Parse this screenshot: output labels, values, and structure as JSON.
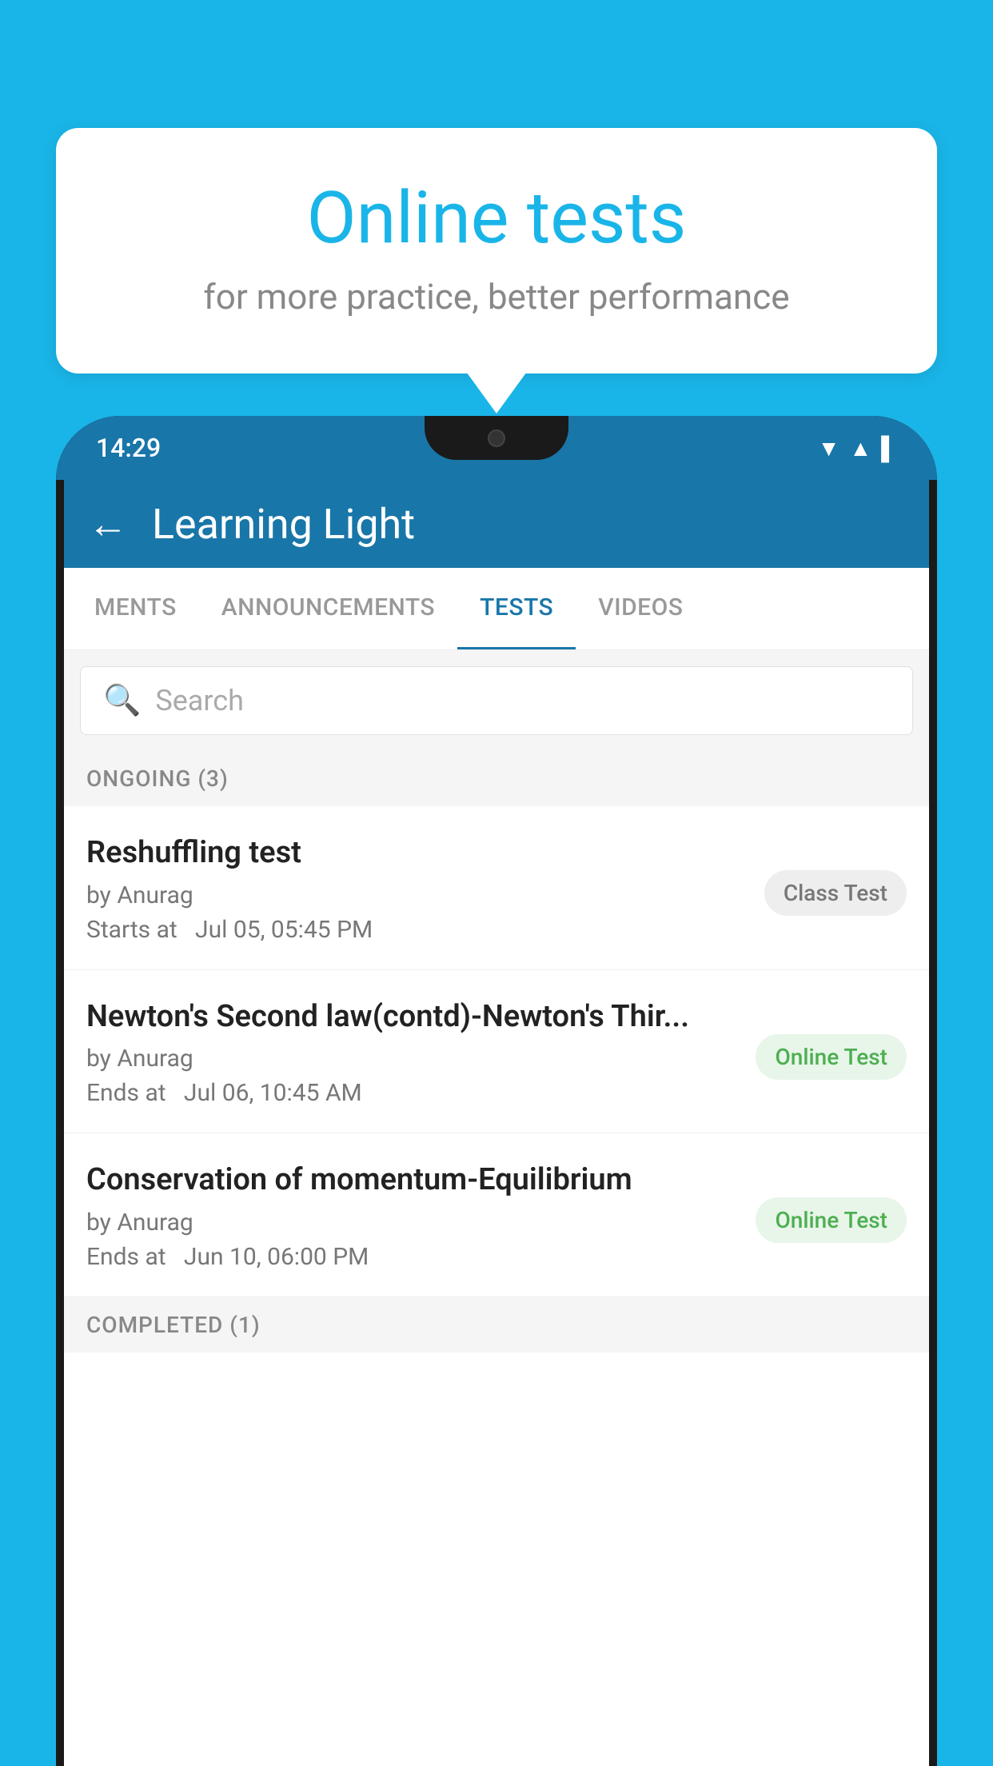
{
  "background_color": "#1ab5e8",
  "bubble": {
    "title": "Online tests",
    "subtitle": "for more practice, better performance"
  },
  "phone": {
    "status_bar": {
      "time": "14:29",
      "icons": [
        "▼",
        "▲",
        "▌"
      ]
    },
    "app_header": {
      "back_label": "←",
      "title": "Learning Light"
    },
    "tabs": [
      {
        "label": "MENTS",
        "active": false
      },
      {
        "label": "ANNOUNCEMENTS",
        "active": false
      },
      {
        "label": "TESTS",
        "active": true
      },
      {
        "label": "VIDEOS",
        "active": false
      }
    ],
    "search": {
      "placeholder": "Search",
      "icon": "🔍"
    },
    "sections": [
      {
        "label": "ONGOING (3)",
        "items": [
          {
            "name": "Reshuffling test",
            "author": "by Anurag",
            "time_label": "Starts at",
            "time": "Jul 05, 05:45 PM",
            "badge": "Class Test",
            "badge_type": "class"
          },
          {
            "name": "Newton's Second law(contd)-Newton's Thir...",
            "author": "by Anurag",
            "time_label": "Ends at",
            "time": "Jul 06, 10:45 AM",
            "badge": "Online Test",
            "badge_type": "online"
          },
          {
            "name": "Conservation of momentum-Equilibrium",
            "author": "by Anurag",
            "time_label": "Ends at",
            "time": "Jun 10, 06:00 PM",
            "badge": "Online Test",
            "badge_type": "online"
          }
        ]
      },
      {
        "label": "COMPLETED (1)",
        "items": []
      }
    ]
  }
}
